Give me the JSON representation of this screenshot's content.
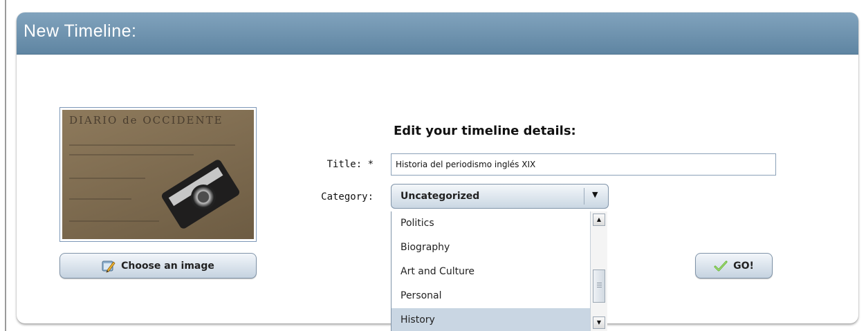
{
  "panel": {
    "title": "New Timeline:"
  },
  "image": {
    "headline": "DIARIO de OCCIDENTE",
    "choose_label": "Choose an image"
  },
  "form": {
    "heading": "Edit your timeline details:",
    "title_label": "Title: *",
    "title_value": "Historia del periodismo inglés XIX",
    "category_label": "Category:",
    "category_selected": "Uncategorized",
    "category_options": [
      "Politics",
      "Biography",
      "Art and Culture",
      "Personal",
      "History"
    ],
    "highlighted_option": "History",
    "go_label": "GO!"
  },
  "icons": {
    "choose": "edit-image-icon",
    "go": "checkmark-icon",
    "select_arrow": "chevron-down-icon",
    "scroll_up": "scroll-up-icon",
    "scroll_down": "scroll-down-icon"
  },
  "colors": {
    "header": "#6e93af",
    "button": "#d6e1eb",
    "highlight": "#c9d6e3",
    "checkmark": "#5fb52b"
  }
}
